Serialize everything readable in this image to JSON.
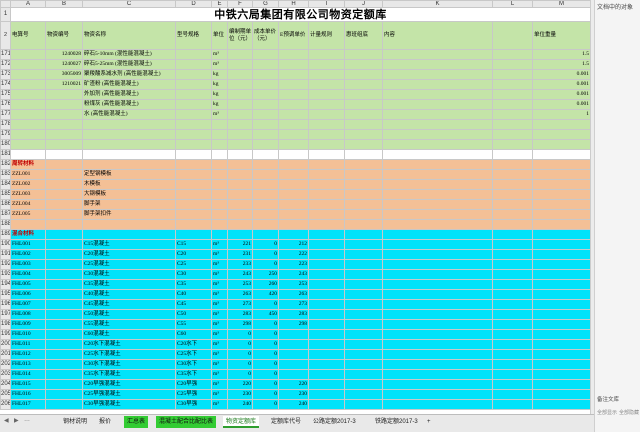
{
  "sheet": {
    "col_headers": [
      "A",
      "B",
      "C",
      "D",
      "E",
      "F",
      "G",
      "H",
      "I",
      "J",
      "K",
      "L",
      "M"
    ],
    "title": {
      "row": "1",
      "text": "中铁六局集团有限公司物资定额库"
    },
    "header": {
      "row": "2",
      "cells": [
        "电算号",
        "物资编号",
        "物资名称",
        "型号规格",
        "单位",
        "编制期单位（元）",
        "成本单价（元）",
        "E预调单价",
        "计量规则",
        "惠班组底",
        "内容",
        "",
        "单位重量",
        "2017年基"
      ]
    },
    "rows": [
      {
        "n": "171",
        "band": "g",
        "cells": [
          "",
          "1240028",
          "碎石5-10mm (混性能混凝土)",
          "",
          "m³",
          "",
          "",
          "",
          "",
          "",
          "",
          "",
          "1.5",
          ""
        ]
      },
      {
        "n": "172",
        "band": "g",
        "cells": [
          "",
          "1240027",
          "碎石5-25mm (混性能混凝土)",
          "",
          "m³",
          "",
          "",
          "",
          "",
          "",
          "",
          "",
          "1.5",
          ""
        ]
      },
      {
        "n": "173",
        "band": "g",
        "cells": [
          "",
          "3005009",
          "聚羧酸系减水剂 (高性能混凝土)",
          "",
          "kg",
          "",
          "",
          "",
          "",
          "",
          "",
          "",
          "0.001",
          ""
        ]
      },
      {
        "n": "174",
        "band": "g",
        "cells": [
          "",
          "1210021",
          "矿渣粉 (高性能混凝土)",
          "",
          "kg",
          "",
          "",
          "",
          "",
          "",
          "",
          "",
          "0.001",
          ""
        ]
      },
      {
        "n": "175",
        "band": "g",
        "cells": [
          "",
          "",
          "外加剂 (高性能混凝土)",
          "",
          "kg",
          "",
          "",
          "",
          "",
          "",
          "",
          "",
          "0.001",
          ""
        ]
      },
      {
        "n": "176",
        "band": "g",
        "cells": [
          "",
          "",
          "粉煤灰 (高性能混凝土)",
          "",
          "kg",
          "",
          "",
          "",
          "",
          "",
          "",
          "",
          "0.001",
          ""
        ]
      },
      {
        "n": "177",
        "band": "g",
        "cells": [
          "",
          "",
          "水 (高性能混凝土)",
          "",
          "m³",
          "",
          "",
          "",
          "",
          "",
          "",
          "",
          "1",
          ""
        ]
      },
      {
        "n": "178",
        "band": "g",
        "cells": [
          "",
          "",
          "",
          "",
          "",
          "",
          "",
          "",
          "",
          "",
          "",
          "",
          "",
          ""
        ]
      },
      {
        "n": "179",
        "band": "g",
        "cells": [
          "",
          "",
          "",
          "",
          "",
          "",
          "",
          "",
          "",
          "",
          "",
          "",
          "",
          ""
        ]
      },
      {
        "n": "180",
        "band": "g",
        "cells": [
          "",
          "",
          "",
          "",
          "",
          "",
          "",
          "",
          "",
          "",
          "",
          "",
          "",
          ""
        ]
      },
      {
        "n": "181",
        "band": "w",
        "cells": [
          "",
          "",
          "",
          "",
          "",
          "",
          "",
          "",
          "",
          "",
          "",
          "",
          "",
          ""
        ]
      },
      {
        "n": "182",
        "band": "o",
        "red": true,
        "cells": [
          "周转材料",
          "",
          "",
          "",
          "",
          "",
          "",
          "",
          "",
          "",
          "",
          "",
          "",
          ""
        ]
      },
      {
        "n": "183",
        "band": "o",
        "cells": [
          "ZZL001",
          "",
          "定型钢模板",
          "",
          "",
          "",
          "",
          "",
          "",
          "",
          "",
          "",
          "",
          ""
        ]
      },
      {
        "n": "184",
        "band": "o",
        "cells": [
          "ZZL002",
          "",
          "木模板",
          "",
          "",
          "",
          "",
          "",
          "",
          "",
          "",
          "",
          "",
          ""
        ]
      },
      {
        "n": "185",
        "band": "o",
        "cells": [
          "ZZL003",
          "",
          "大钢模板",
          "",
          "",
          "",
          "",
          "",
          "",
          "",
          "",
          "",
          "",
          ""
        ]
      },
      {
        "n": "186",
        "band": "o",
        "cells": [
          "ZZL004",
          "",
          "脚手架",
          "",
          "",
          "",
          "",
          "",
          "",
          "",
          "",
          "",
          "",
          ""
        ]
      },
      {
        "n": "187",
        "band": "o",
        "cells": [
          "ZZL005",
          "",
          "脚手架扣件",
          "",
          "",
          "",
          "",
          "",
          "",
          "",
          "",
          "",
          "",
          ""
        ]
      },
      {
        "n": "188",
        "band": "o",
        "cells": [
          "",
          "",
          "",
          "",
          "",
          "",
          "",
          "",
          "",
          "",
          "",
          "",
          "",
          ""
        ]
      },
      {
        "n": "189",
        "band": "c",
        "red": true,
        "cells": [
          "混合材料",
          "",
          "",
          "",
          "",
          "",
          "",
          "",
          "",
          "",
          "",
          "",
          "",
          ""
        ]
      },
      {
        "n": "190",
        "band": "c",
        "cells": [
          "FHL001",
          "",
          "C15混凝土",
          "C15",
          "m³",
          "221",
          "0",
          "212",
          "",
          "",
          "",
          "",
          "",
          ""
        ]
      },
      {
        "n": "191",
        "band": "c",
        "cells": [
          "FHL002",
          "",
          "C20混凝土",
          "C20",
          "m³",
          "231",
          "0",
          "222",
          "",
          "",
          "",
          "",
          "",
          ""
        ]
      },
      {
        "n": "192",
        "band": "c",
        "cells": [
          "FHL003",
          "",
          "C25混凝土",
          "C25",
          "m³",
          "233",
          "0",
          "223",
          "",
          "",
          "",
          "",
          "",
          ""
        ]
      },
      {
        "n": "193",
        "band": "c",
        "cells": [
          "FHL004",
          "",
          "C30混凝土",
          "C30",
          "m³",
          "243",
          "250",
          "243",
          "",
          "",
          "",
          "",
          "",
          ""
        ]
      },
      {
        "n": "194",
        "band": "c",
        "cells": [
          "FHL005",
          "",
          "C35混凝土",
          "C35",
          "m³",
          "253",
          "260",
          "253",
          "",
          "",
          "",
          "",
          "",
          ""
        ]
      },
      {
        "n": "195",
        "band": "c",
        "cells": [
          "FHL006",
          "",
          "C40混凝土",
          "C40",
          "m³",
          "263",
          "420",
          "263",
          "",
          "",
          "",
          "",
          "",
          ""
        ]
      },
      {
        "n": "196",
        "band": "c",
        "cells": [
          "FHL007",
          "",
          "C45混凝土",
          "C45",
          "m³",
          "273",
          "0",
          "273",
          "",
          "",
          "",
          "",
          "",
          ""
        ]
      },
      {
        "n": "197",
        "band": "c",
        "cells": [
          "FHL008",
          "",
          "C50混凝土",
          "C50",
          "m³",
          "283",
          "450",
          "283",
          "",
          "",
          "",
          "",
          "",
          ""
        ]
      },
      {
        "n": "198",
        "band": "c",
        "cells": [
          "FHL009",
          "",
          "C55混凝土",
          "C55",
          "m³",
          "298",
          "0",
          "298",
          "",
          "",
          "",
          "",
          "",
          ""
        ]
      },
      {
        "n": "199",
        "band": "c",
        "cells": [
          "FHL010",
          "",
          "C60混凝土",
          "C60",
          "m³",
          "0",
          "0",
          "",
          "",
          "",
          "",
          "",
          "",
          ""
        ]
      },
      {
        "n": "200",
        "band": "c",
        "cells": [
          "FHL011",
          "",
          "C20水下混凝土",
          "C20水下",
          "m³",
          "0",
          "0",
          "",
          "",
          "",
          "",
          "",
          "",
          ""
        ]
      },
      {
        "n": "201",
        "band": "c",
        "cells": [
          "FHL012",
          "",
          "C25水下混凝土",
          "C25水下",
          "m³",
          "0",
          "0",
          "",
          "",
          "",
          "",
          "",
          "",
          ""
        ]
      },
      {
        "n": "202",
        "band": "c",
        "cells": [
          "FHL013",
          "",
          "C30水下混凝土",
          "C30水下",
          "m³",
          "0",
          "0",
          "",
          "",
          "",
          "",
          "",
          "",
          ""
        ]
      },
      {
        "n": "203",
        "band": "c",
        "cells": [
          "FHL014",
          "",
          "C35水下混凝土",
          "C35水下",
          "m³",
          "0",
          "0",
          "",
          "",
          "",
          "",
          "",
          "",
          ""
        ]
      },
      {
        "n": "204",
        "band": "c",
        "cells": [
          "FHL015",
          "",
          "C20早强混凝土",
          "C20早强",
          "m³",
          "220",
          "0",
          "220",
          "",
          "",
          "",
          "",
          "",
          ""
        ]
      },
      {
        "n": "205",
        "band": "c",
        "cells": [
          "FHL016",
          "",
          "C25早强混凝土",
          "C25早强",
          "m³",
          "230",
          "0",
          "230",
          "",
          "",
          "",
          "",
          "",
          ""
        ]
      },
      {
        "n": "206",
        "band": "c",
        "cells": [
          "FHL017",
          "",
          "C30早强混凝土",
          "C30早强",
          "m³",
          "240",
          "0",
          "240",
          "",
          "",
          "",
          "",
          "",
          ""
        ]
      }
    ]
  },
  "sidebar": {
    "title": "文档中的对象",
    "tab": "备注文库",
    "show_all": "全部显示",
    "hide_all": "全部隐藏"
  },
  "tabs": {
    "items": [
      "钢材说明",
      "报价",
      "汇总表",
      "混凝土配合比配比表",
      "物资定额库",
      "定额库代号",
      "公路定额2017-3",
      "铁路定额2017-3",
      "+"
    ],
    "active_index": 4
  }
}
